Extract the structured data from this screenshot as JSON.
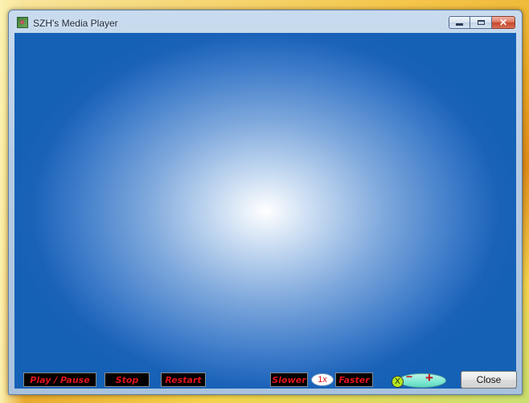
{
  "window": {
    "title": "SZH's Media Player",
    "icon": "app-icon",
    "caption_buttons": {
      "minimize": "minimize-icon",
      "maximize": "maximize-icon",
      "close": "✕"
    }
  },
  "controls": {
    "play_pause": "Play / Pause",
    "stop": "Stop",
    "restart": "Restart",
    "slower": "Slower",
    "speed": "1x",
    "faster": "Faster",
    "volume": {
      "mute": "X",
      "minus": "−",
      "plus": "+"
    },
    "close": "Close"
  },
  "colors": {
    "button_text": "#e0141c",
    "button_bg": "#000000",
    "video_area": "#1461b6",
    "volume_oval": "#7ee8d2",
    "mute_dot": "#b5e61d"
  }
}
